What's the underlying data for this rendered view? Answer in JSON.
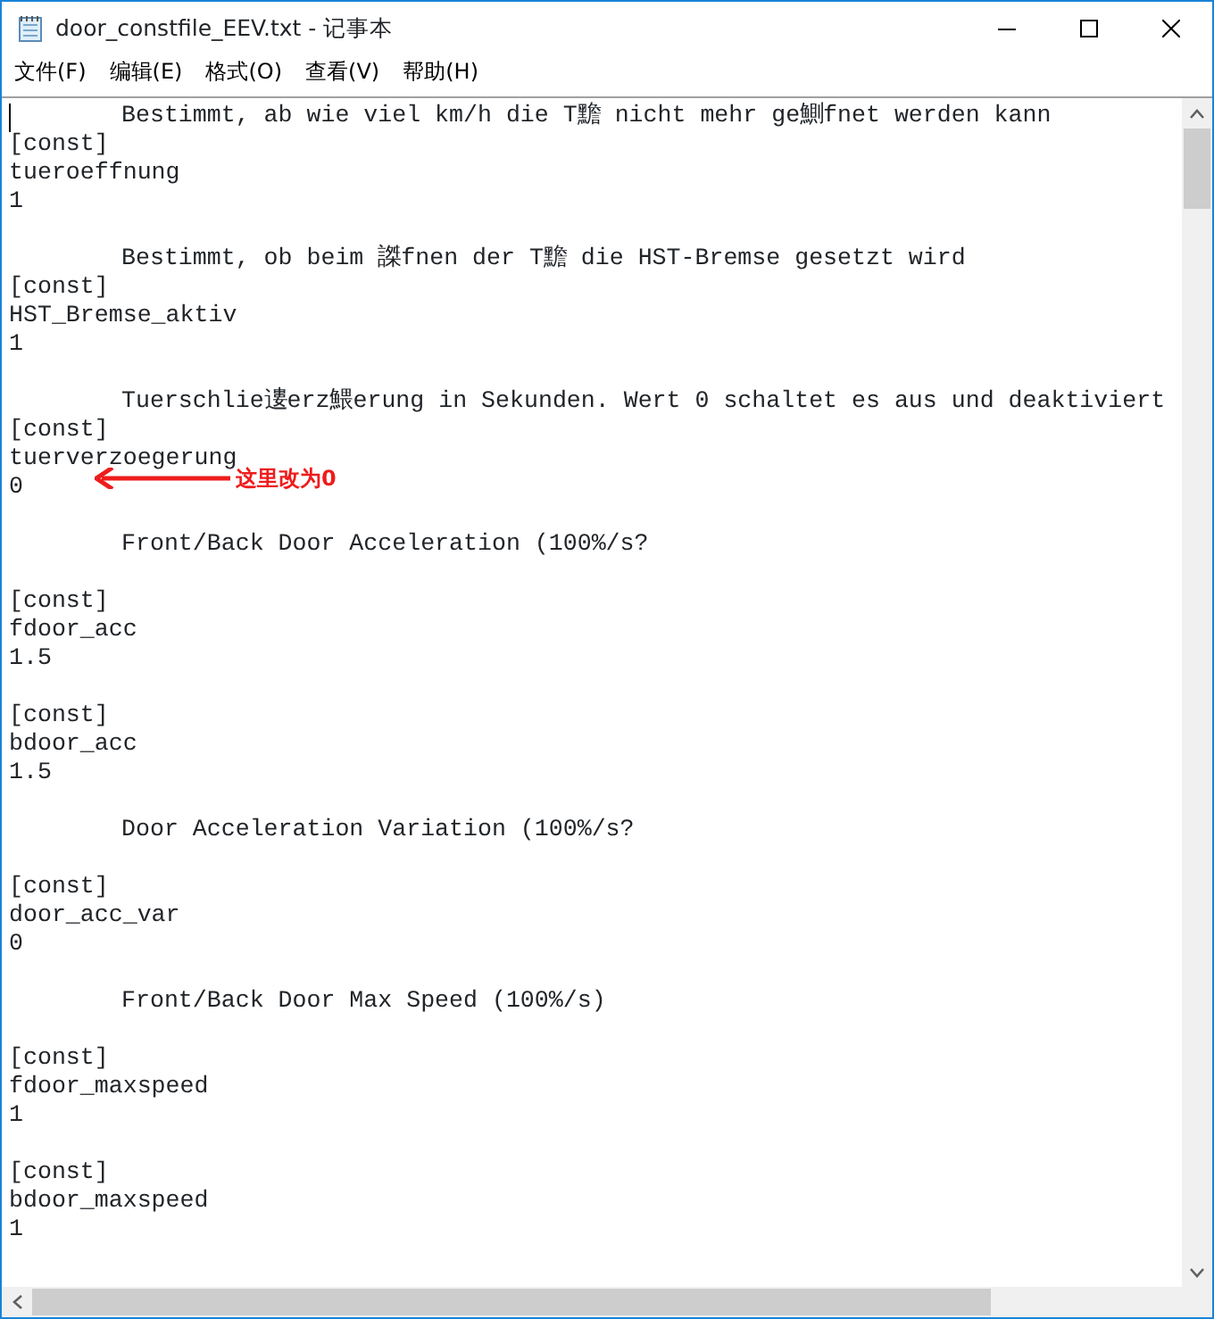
{
  "window": {
    "title": "door_constfile_EEV.txt - 记事本"
  },
  "menu": [
    "文件(F)",
    "编辑(E)",
    "格式(O)",
    "查看(V)",
    "帮助(H)"
  ],
  "lines": [
    {
      "kind": "text",
      "indent": true,
      "text": "Bestimmt, ab wie viel km/h die T黵 nicht mehr ge鰂fnet werden kann"
    },
    {
      "kind": "text",
      "indent": false,
      "text": "[const]"
    },
    {
      "kind": "text",
      "indent": false,
      "text": "tueroeffnung"
    },
    {
      "kind": "text",
      "indent": false,
      "text": "1"
    },
    {
      "kind": "blank"
    },
    {
      "kind": "text",
      "indent": true,
      "text": "Bestimmt, ob beim 謋fnen der T黵 die HST-Bremse gesetzt wird"
    },
    {
      "kind": "text",
      "indent": false,
      "text": "[const]"
    },
    {
      "kind": "text",
      "indent": false,
      "text": "HST_Bremse_aktiv"
    },
    {
      "kind": "text",
      "indent": false,
      "text": "1"
    },
    {
      "kind": "blank"
    },
    {
      "kind": "text",
      "indent": true,
      "text": "Tuerschlie遱erz鰃erung in Sekunden. Wert 0 schaltet es aus und deaktiviert"
    },
    {
      "kind": "text",
      "indent": false,
      "text": "[const]"
    },
    {
      "kind": "text",
      "indent": false,
      "text": "tuerverzoegerung"
    },
    {
      "kind": "text",
      "indent": false,
      "text": "0"
    },
    {
      "kind": "blank"
    },
    {
      "kind": "text",
      "indent": true,
      "text": "Front/Back Door Acceleration (100%/s?"
    },
    {
      "kind": "blank"
    },
    {
      "kind": "text",
      "indent": false,
      "text": "[const]"
    },
    {
      "kind": "text",
      "indent": false,
      "text": "fdoor_acc"
    },
    {
      "kind": "text",
      "indent": false,
      "text": "1.5"
    },
    {
      "kind": "blank"
    },
    {
      "kind": "text",
      "indent": false,
      "text": "[const]"
    },
    {
      "kind": "text",
      "indent": false,
      "text": "bdoor_acc"
    },
    {
      "kind": "text",
      "indent": false,
      "text": "1.5"
    },
    {
      "kind": "blank"
    },
    {
      "kind": "text",
      "indent": true,
      "text": "Door Acceleration Variation (100%/s?"
    },
    {
      "kind": "blank"
    },
    {
      "kind": "text",
      "indent": false,
      "text": "[const]"
    },
    {
      "kind": "text",
      "indent": false,
      "text": "door_acc_var"
    },
    {
      "kind": "text",
      "indent": false,
      "text": "0"
    },
    {
      "kind": "blank"
    },
    {
      "kind": "text",
      "indent": true,
      "text": "Front/Back Door Max Speed (100%/s)"
    },
    {
      "kind": "blank"
    },
    {
      "kind": "text",
      "indent": false,
      "text": "[const]"
    },
    {
      "kind": "text",
      "indent": false,
      "text": "fdoor_maxspeed"
    },
    {
      "kind": "text",
      "indent": false,
      "text": "1"
    },
    {
      "kind": "blank"
    },
    {
      "kind": "text",
      "indent": false,
      "text": "[const]"
    },
    {
      "kind": "text",
      "indent": false,
      "text": "bdoor_maxspeed"
    },
    {
      "kind": "text",
      "indent": false,
      "text": "1"
    }
  ],
  "annotation": {
    "text": "这里改为0"
  }
}
